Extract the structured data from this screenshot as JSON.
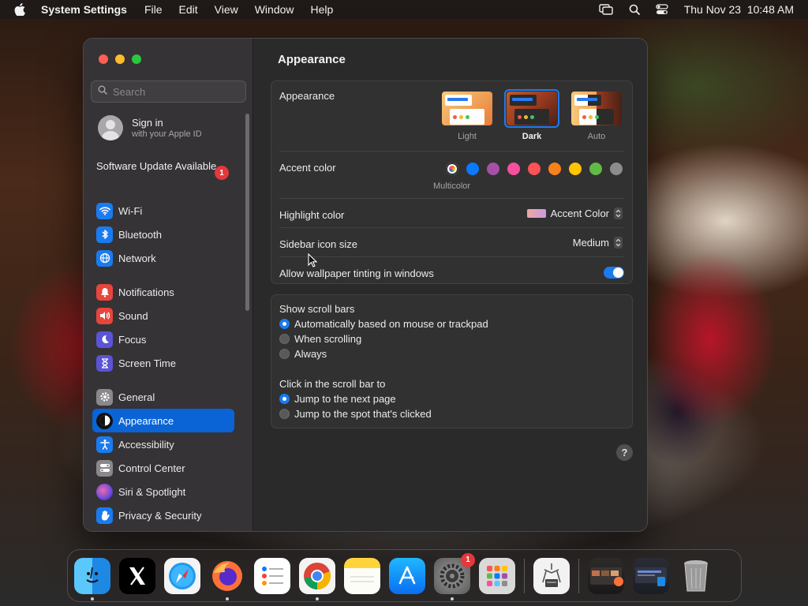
{
  "menubar": {
    "app_name": "System Settings",
    "menus": [
      "File",
      "Edit",
      "View",
      "Window",
      "Help"
    ],
    "datetime": "Thu Nov 23  10:48 AM",
    "icons": [
      "screen-mirroring-icon",
      "spotlight-search-icon",
      "control-center-icon"
    ]
  },
  "sidebar": {
    "search_placeholder": "Search",
    "signin_title": "Sign in",
    "signin_subtitle": "with your Apple ID",
    "software_update": "Software Update Available",
    "software_update_badge": "1",
    "group1": [
      {
        "label": "Wi-Fi",
        "icon": "wifi-icon",
        "color": "#1a7bf0"
      },
      {
        "label": "Bluetooth",
        "icon": "bluetooth-icon",
        "color": "#1a7bf0"
      },
      {
        "label": "Network",
        "icon": "network-globe-icon",
        "color": "#1a7bf0"
      }
    ],
    "group2": [
      {
        "label": "Notifications",
        "icon": "bell-icon",
        "color": "#e8453c"
      },
      {
        "label": "Sound",
        "icon": "speaker-icon",
        "color": "#e8453c"
      },
      {
        "label": "Focus",
        "icon": "moon-icon",
        "color": "#5b54d6"
      },
      {
        "label": "Screen Time",
        "icon": "hourglass-icon",
        "color": "#5b54d6"
      }
    ],
    "group3": [
      {
        "label": "General",
        "icon": "gear-icon",
        "color": "#8a888a"
      },
      {
        "label": "Appearance",
        "icon": "appearance-icon",
        "color": "#111111",
        "active": true
      },
      {
        "label": "Accessibility",
        "icon": "accessibility-icon",
        "color": "#1a7bf0"
      },
      {
        "label": "Control Center",
        "icon": "toggles-icon",
        "color": "#8a888a"
      },
      {
        "label": "Siri & Spotlight",
        "icon": "siri-icon",
        "color": "#2a2a2a"
      },
      {
        "label": "Privacy & Security",
        "icon": "hand-icon",
        "color": "#1a7bf0"
      }
    ]
  },
  "content": {
    "title": "Appearance",
    "appearance_label": "Appearance",
    "appearance_options": [
      {
        "name": "Light",
        "selected": false
      },
      {
        "name": "Dark",
        "selected": true
      },
      {
        "name": "Auto",
        "selected": false
      }
    ],
    "accent_label": "Accent color",
    "accent_colors": [
      "multicolor",
      "#0a7aff",
      "#a550a7",
      "#f74f9e",
      "#ff5257",
      "#f7821b",
      "#ffc600",
      "#62ba46",
      "#8c8c8c"
    ],
    "accent_selected_name": "Multicolor",
    "highlight_label": "Highlight color",
    "highlight_value": "Accent Color",
    "sidebar_icon_label": "Sidebar icon size",
    "sidebar_icon_value": "Medium",
    "wallpaper_tint_label": "Allow wallpaper tinting in windows",
    "wallpaper_tint_on": true,
    "scroll_bars_label": "Show scroll bars",
    "scroll_bars_options": [
      {
        "label": "Automatically based on mouse or trackpad",
        "selected": true
      },
      {
        "label": "When scrolling",
        "selected": false
      },
      {
        "label": "Always",
        "selected": false
      }
    ],
    "click_scroll_label": "Click in the scroll bar to",
    "click_scroll_options": [
      {
        "label": "Jump to the next page",
        "selected": true
      },
      {
        "label": "Jump to the spot that's clicked",
        "selected": false
      }
    ],
    "help_label": "?"
  },
  "dock": {
    "apps": [
      {
        "name": "finder-icon",
        "running": true
      },
      {
        "name": "x-twitter-icon",
        "running": false
      },
      {
        "name": "safari-icon",
        "running": false
      },
      {
        "name": "firefox-icon",
        "running": true
      },
      {
        "name": "reminders-icon",
        "running": false
      },
      {
        "name": "chrome-icon",
        "running": true
      },
      {
        "name": "notes-icon",
        "running": false
      },
      {
        "name": "app-store-icon",
        "running": false
      },
      {
        "name": "system-settings-icon",
        "running": true,
        "badge": "1"
      },
      {
        "name": "launchpad-icon",
        "running": false
      }
    ],
    "extras": [
      "archive-utility-icon"
    ],
    "stack": [
      "downloads-stack-icon",
      "desktop-stack-icon"
    ],
    "trash": "trash-icon"
  }
}
